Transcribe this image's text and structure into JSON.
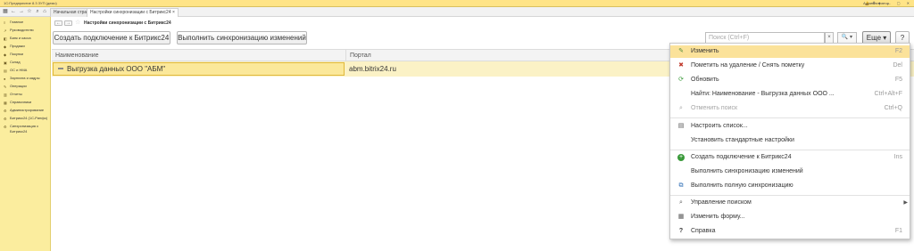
{
  "titlebar": {
    "app_title": "1С:Предприятие 8.3 ЗУП (демо)",
    "user": "Администратор",
    "window_controls": "— ▢ ✕"
  },
  "tabs": [
    {
      "label": "Начальная страница"
    },
    {
      "label": "Настройки синхронизации с Битрикс24",
      "close": "×"
    }
  ],
  "sidebar": {
    "items": [
      {
        "label": "Главное",
        "icon": "≡"
      },
      {
        "label": "Руководителю",
        "icon": "↗"
      },
      {
        "label": "Банк и касса",
        "icon": "◧"
      },
      {
        "label": "Продажи",
        "icon": "◆"
      },
      {
        "label": "Покупки",
        "icon": "◆"
      },
      {
        "label": "Склад",
        "icon": "▣"
      },
      {
        "label": "ОС и НМА",
        "icon": "▤"
      },
      {
        "label": "Зарплата и кадры",
        "icon": "●"
      },
      {
        "label": "Операции",
        "icon": "✎"
      },
      {
        "label": "Отчеты",
        "icon": "▥"
      },
      {
        "label": "Справочники",
        "icon": "▦"
      },
      {
        "label": "Администрирование",
        "icon": "⚙"
      },
      {
        "label": "Битрикс24 (1С-Ринфо)",
        "icon": "⚙"
      },
      {
        "label": "Синхронизация с",
        "label2": "Битрикс24",
        "icon": "⚙"
      }
    ]
  },
  "header": {
    "back": "←",
    "forward": "→",
    "star": "☆",
    "page_title": "Настройки синхронизации с Битрикс24"
  },
  "toolbar": {
    "create_label": "Создать подключение к Битрикс24",
    "sync_label": "Выполнить синхронизацию изменений",
    "search_placeholder": "Поиск (Ctrl+F)",
    "search_clear": "×",
    "search_btn": "🔍 ▾",
    "more_label": "Еще ▾",
    "help_label": "?"
  },
  "table": {
    "columns": [
      "Наименование",
      "Портал"
    ],
    "rows": [
      {
        "name": "Выгрузка данных ООО \"АБМ\"",
        "portal": "abm.bitrix24.ru"
      }
    ]
  },
  "menu": {
    "items": [
      {
        "label": "Изменить",
        "key": "F2",
        "icon": "✎"
      },
      {
        "label": "Пометить на удаление / Снять пометку",
        "key": "Del",
        "icon": "✖"
      },
      {
        "label": "Обновить",
        "key": "F5",
        "icon": "⟳"
      },
      {
        "label": "Найти: Наименование - Выгрузка данных ООО ...",
        "key": "Ctrl+Alt+F",
        "icon": ""
      },
      {
        "label": "Отменить поиск",
        "key": "Ctrl+Q",
        "icon": "⌕"
      },
      {
        "label": "Настроить список...",
        "key": "",
        "icon": "▤"
      },
      {
        "label": "Установить стандартные настройки",
        "key": "",
        "icon": ""
      },
      {
        "label": "Создать подключение к Битрикс24",
        "key": "Ins",
        "icon": "+"
      },
      {
        "label": "Выполнить синхронизацию изменений",
        "key": "",
        "icon": ""
      },
      {
        "label": "Выполнить полную синхронизацию",
        "key": "",
        "icon": "⧉"
      },
      {
        "label": "Управление поиском",
        "key": "",
        "icon": "⌕",
        "arrow": "▶"
      },
      {
        "label": "Изменить форму...",
        "key": "",
        "icon": "▦"
      },
      {
        "label": "Справка",
        "key": "F1",
        "icon": "?"
      }
    ]
  },
  "colors": {
    "sidebar_bg": "#fbed9e",
    "titlebar_bg": "#ffe487",
    "selected_row": "#fbe89a",
    "menu_highlight": "#fbe29a"
  }
}
